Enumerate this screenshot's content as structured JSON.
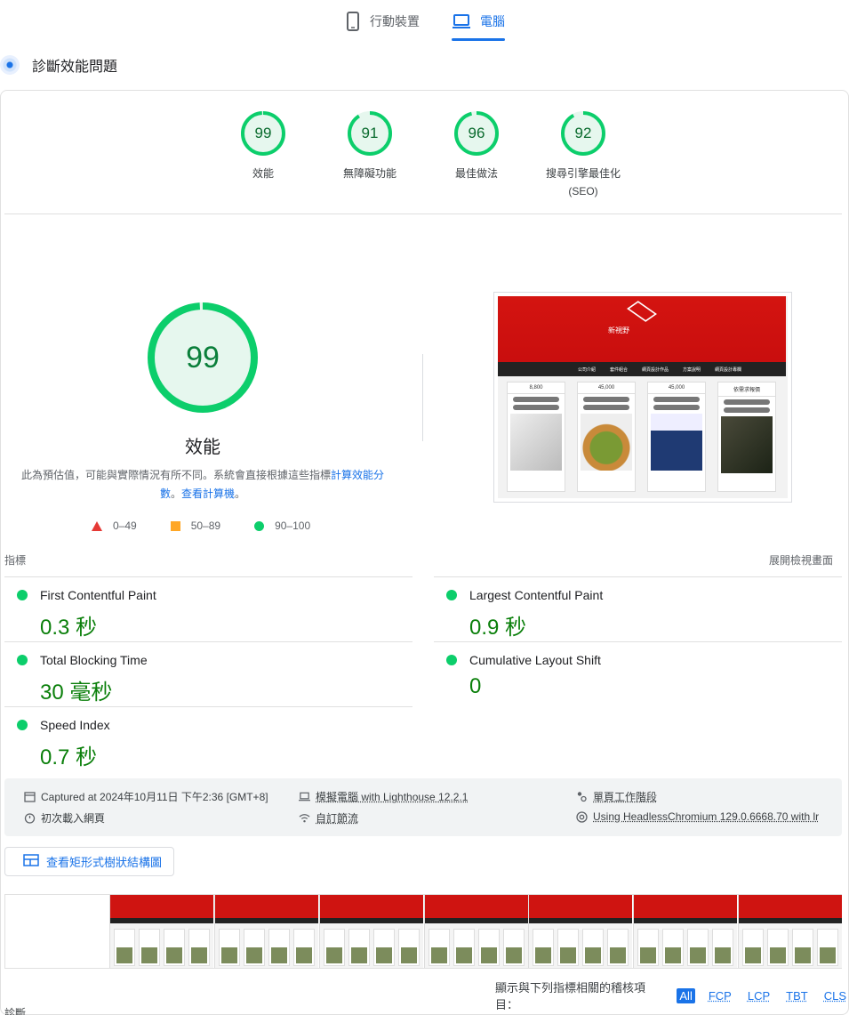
{
  "tabs": [
    {
      "label": "行動裝置",
      "icon": "mobile-phone-icon",
      "active": false
    },
    {
      "label": "電腦",
      "icon": "laptop-icon",
      "active": true
    }
  ],
  "diagnose_header": {
    "title": "診斷效能問題"
  },
  "categories": [
    {
      "score": "99",
      "label": "效能",
      "fraction": 0.99
    },
    {
      "score": "91",
      "label": "無障礙功能",
      "fraction": 0.91
    },
    {
      "score": "96",
      "label": "最佳做法",
      "fraction": 0.96
    },
    {
      "score": "92",
      "label": "搜尋引擎最佳化",
      "sublabel": "(SEO)",
      "fraction": 0.92
    }
  ],
  "performance": {
    "score": "99",
    "fraction": 0.99,
    "title": "效能",
    "estimate_text": "此為預估值，可能與實際情況有所不同。系統會直接根據這些指標",
    "calc_link": "計算效能分數",
    "period": "。",
    "calculator_link": "查看計算機",
    "end": "。"
  },
  "legend": [
    {
      "shape": "triangle",
      "range": "0–49",
      "color": "#e53935"
    },
    {
      "shape": "square",
      "range": "50–89",
      "color": "#ffa726"
    },
    {
      "shape": "circle",
      "range": "90–100",
      "color": "#0cce6b"
    }
  ],
  "preview": {
    "brand": "新視野",
    "nav": [
      "公司介紹",
      "套件組合",
      "網頁設計作品",
      "方案說明",
      "網頁設計專欄"
    ],
    "cards": [
      {
        "price": "8,800"
      },
      {
        "price": "45,000"
      },
      {
        "price": "45,000"
      },
      {
        "price": "依需求報價"
      }
    ]
  },
  "metrics": {
    "header": "指標",
    "expand": "展開檢視畫面",
    "items": [
      {
        "name": "First Contentful Paint",
        "value": "0.3 秒"
      },
      {
        "name": "Largest Contentful Paint",
        "value": "0.9 秒"
      },
      {
        "name": "Total Blocking Time",
        "value": "30 毫秒"
      },
      {
        "name": "Cumulative Layout Shift",
        "value": "0"
      },
      {
        "name": "Speed Index",
        "value": "0.7 秒"
      }
    ]
  },
  "runtime": {
    "captured": "Captured at 2024年10月11日 下午2:36 [GMT+8]",
    "initial_load": "初次載入網頁",
    "emulated": "模擬電腦 with Lighthouse 12.2.1",
    "throttling": "自訂節流",
    "single_session": "單頁工作階段",
    "browser": "Using HeadlessChromium 129.0.6668.70 with lr"
  },
  "treemap": {
    "label": "查看矩形式樹狀結構圖"
  },
  "filter": {
    "label": "顯示與下列指標相關的稽核項目：",
    "chips": [
      "All",
      "FCP",
      "LCP",
      "TBT",
      "CLS"
    ]
  },
  "diagnostics": {
    "label": "診斷"
  },
  "colors": {
    "good": "#0cce6b",
    "good_text": "#0a7f3a",
    "accent": "#1a73e8"
  }
}
